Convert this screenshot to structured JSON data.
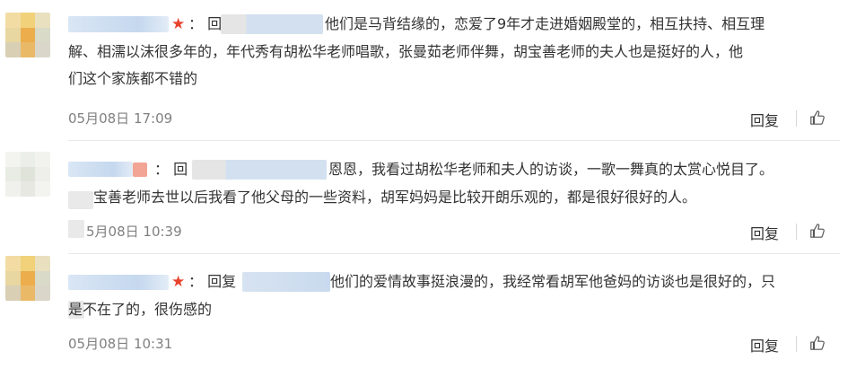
{
  "comments": [
    {
      "prefix": "：  回",
      "lines": [
        "他们是马背结缘的，恋爱了9年才走进婚姻殿堂的，相互扶持、相互理",
        "解、相濡以沫很多年的，年代秀有胡松华老师唱歌，张曼茹老师伴舞，胡宝善老师的夫人也是挺好的人，他",
        "们这个家族都不错的"
      ],
      "date": "05月08日 17:09",
      "reply_label": "回复"
    },
    {
      "prefix": "：  回",
      "lines": [
        "恩恩，我看过胡松华老师和夫人的访谈，一歌一舞真的太赏心悦目了。",
        "宝善老师去世以后我看了他父母的一些资料，胡军妈妈是比较开朗乐观的，都是很好很好的人。"
      ],
      "date": "5月08日 10:39",
      "reply_label": "回复"
    },
    {
      "prefix": "：  回复",
      "lines": [
        "他们的爱情故事挺浪漫的，我经常看胡军他爸妈的访谈也是很好的，只",
        "是不在了的，很伤感的"
      ],
      "date": "05月08日 10:31",
      "reply_label": "回复"
    }
  ],
  "colors": {
    "text": "#333333",
    "meta": "#808080",
    "star": "#e8412c",
    "divider": "#e8e8e8"
  },
  "icons": {
    "like": "thumbs-up-icon",
    "badge": "star-icon"
  }
}
